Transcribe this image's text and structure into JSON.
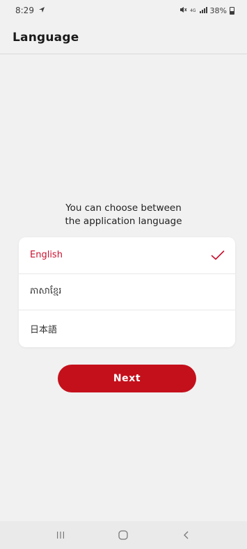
{
  "status_bar": {
    "time": "8:29",
    "location_icon": "navigation-arrow-icon",
    "icons_text": "4G",
    "battery": "38%"
  },
  "header": {
    "title": "Language"
  },
  "prompt": {
    "line1": "You can choose between",
    "line2": "the application language"
  },
  "languages": [
    {
      "label": "English",
      "selected": true
    },
    {
      "label": "ភាសាខ្មែរ",
      "selected": false
    },
    {
      "label": "日本語",
      "selected": false
    }
  ],
  "next_button": {
    "label": "Next"
  },
  "colors": {
    "accent": "#c4101b",
    "selected_text": "#c8102e",
    "background": "#f1f1f1",
    "card": "#ffffff"
  },
  "nav_bar": {
    "recent": "recent-apps-icon",
    "home": "home-icon",
    "back": "back-icon"
  }
}
